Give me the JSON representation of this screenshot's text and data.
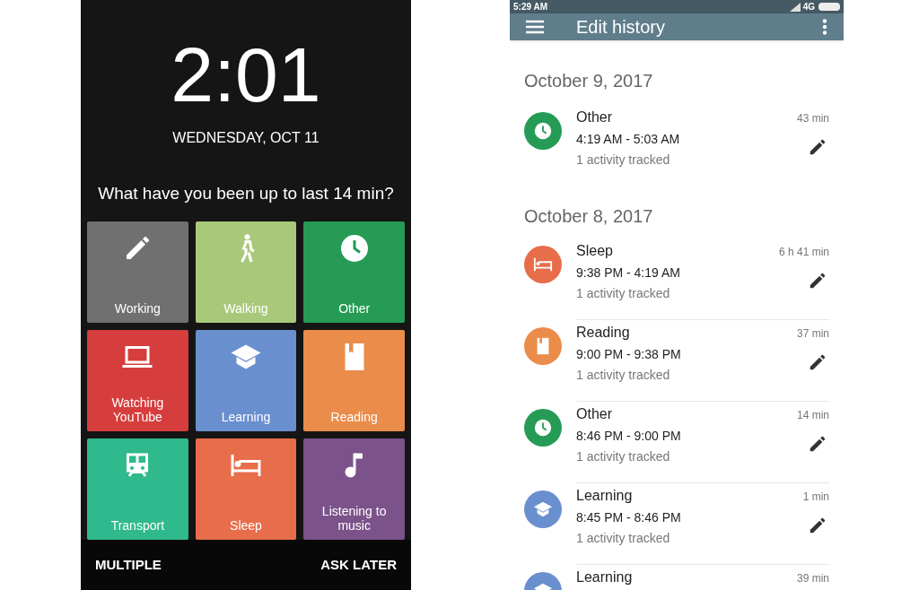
{
  "lock_screen": {
    "time": "2:01",
    "date": "WEDNESDAY, OCT 11",
    "question": "What have you been up to last 14 min?",
    "tiles": [
      {
        "label": "Working",
        "kind": "work",
        "color": "#707070"
      },
      {
        "label": "Walking",
        "kind": "walk",
        "color": "#a9c97a"
      },
      {
        "label": "Other",
        "kind": "other",
        "color": "#259b55"
      },
      {
        "label": "Watching YouTube",
        "kind": "video",
        "color": "#d63d3d"
      },
      {
        "label": "Learning",
        "kind": "learn",
        "color": "#6a8fcf"
      },
      {
        "label": "Reading",
        "kind": "read",
        "color": "#ea8c4a"
      },
      {
        "label": "Transport",
        "kind": "transport",
        "color": "#2fb98c"
      },
      {
        "label": "Sleep",
        "kind": "sleep",
        "color": "#e86d4a"
      },
      {
        "label": "Listening to music",
        "kind": "music",
        "color": "#7b5289"
      }
    ],
    "actions": [
      "MULTIPLE",
      "ASK LATER"
    ]
  },
  "history": {
    "status_bar": {
      "time": "5:29 AM",
      "network": "4G"
    },
    "title": "Edit history",
    "sections": [
      {
        "date": "October 9, 2017",
        "entries": [
          {
            "title": "Other",
            "range": "4:19 AM - 5:03 AM",
            "subtitle": "1 activity tracked",
            "duration": "43 min",
            "kind": "other",
            "color": "#259b55"
          }
        ]
      },
      {
        "date": "October 8, 2017",
        "entries": [
          {
            "title": "Sleep",
            "range": "9:38 PM - 4:19 AM",
            "subtitle": "1 activity tracked",
            "duration": "6 h 41 min",
            "kind": "sleep",
            "color": "#e86d4a"
          },
          {
            "title": "Reading",
            "range": "9:00 PM - 9:38 PM",
            "subtitle": "1 activity tracked",
            "duration": "37 min",
            "kind": "read",
            "color": "#ea8c4a"
          },
          {
            "title": "Other",
            "range": "8:46 PM - 9:00 PM",
            "subtitle": "1 activity tracked",
            "duration": "14 min",
            "kind": "other",
            "color": "#259b55"
          },
          {
            "title": "Learning",
            "range": "8:45 PM - 8:46 PM",
            "subtitle": "1 activity tracked",
            "duration": "1 min",
            "kind": "learn",
            "color": "#6a8fcf"
          },
          {
            "title": "Learning",
            "duration": "39 min",
            "kind": "learn",
            "color": "#6a8fcf"
          }
        ]
      }
    ]
  }
}
